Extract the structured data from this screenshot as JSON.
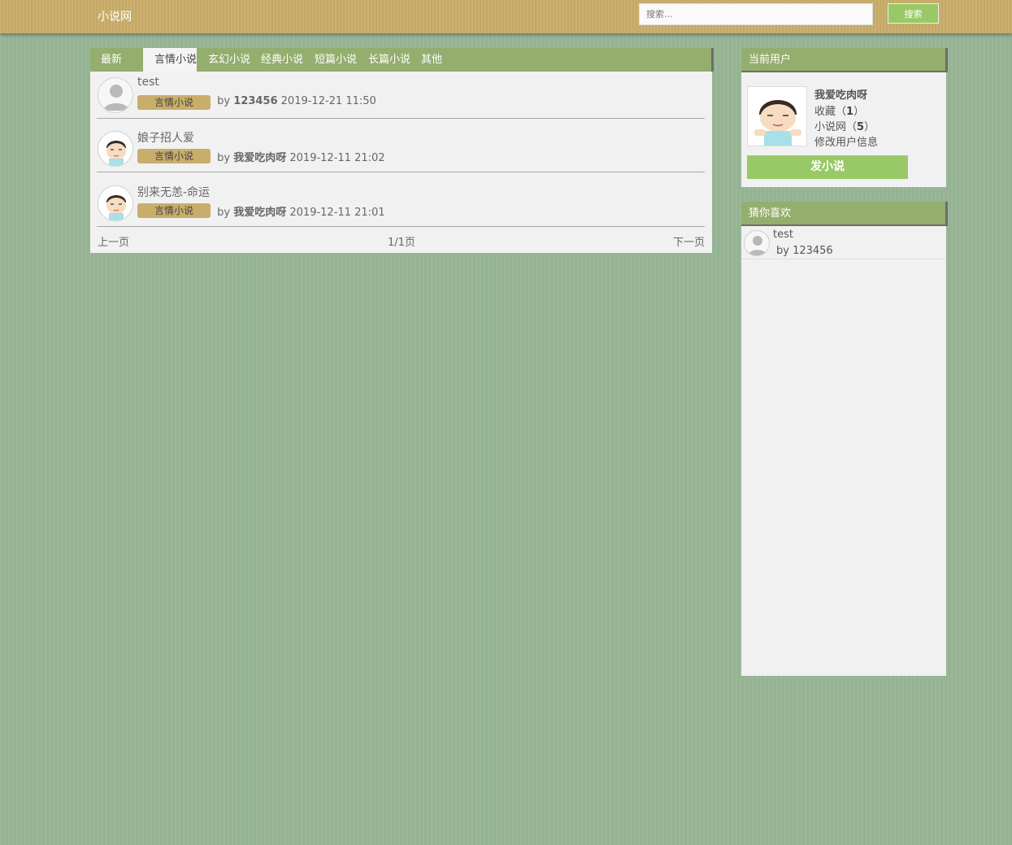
{
  "header": {
    "brand": "小说网",
    "search_placeholder": "搜索...",
    "search_button": "搜索"
  },
  "tabs": [
    {
      "label": "最新",
      "active": false
    },
    {
      "label": "言情小说",
      "active": true
    },
    {
      "label": "玄幻小说",
      "active": false
    },
    {
      "label": "经典小说",
      "active": false
    },
    {
      "label": "短篇小说",
      "active": false
    },
    {
      "label": "长篇小说",
      "active": false
    },
    {
      "label": "其他",
      "active": false
    }
  ],
  "posts": [
    {
      "title": "test",
      "category": "言情小说",
      "by": "by",
      "author": "123456",
      "time": "2019-12-21 11:50",
      "avatar": "default-user-icon"
    },
    {
      "title": "娘子招人爱",
      "category": "言情小说",
      "by": "by",
      "author": "我爱吃肉呀",
      "time": "2019-12-11 21:02",
      "avatar": "cartoon-avatar"
    },
    {
      "title": "别来无恙-命运",
      "category": "言情小说",
      "by": "by",
      "author": "我爱吃肉呀",
      "time": "2019-12-11 21:01",
      "avatar": "cartoon-avatar"
    }
  ],
  "pager": {
    "prev": "上一页",
    "page": "1/1页",
    "next": "下一页"
  },
  "user_panel": {
    "title": "当前用户",
    "username": "我爱吃肉呀",
    "favorites_label": "收藏（",
    "favorites_count": "1",
    "favorites_close": "）",
    "novels_label": "小说网（",
    "novels_count": "5",
    "novels_close": "）",
    "edit_profile": "修改用户信息",
    "post_button": "发小说"
  },
  "recommend": {
    "title": "猜你喜欢",
    "items": [
      {
        "title": "test",
        "by": "by 123456"
      }
    ]
  },
  "colors": {
    "background": "#98b696",
    "topbar": "#c9ad6a",
    "panel_header": "#94ae6e",
    "button_green": "#98c966",
    "badge": "#c9ad6a"
  }
}
